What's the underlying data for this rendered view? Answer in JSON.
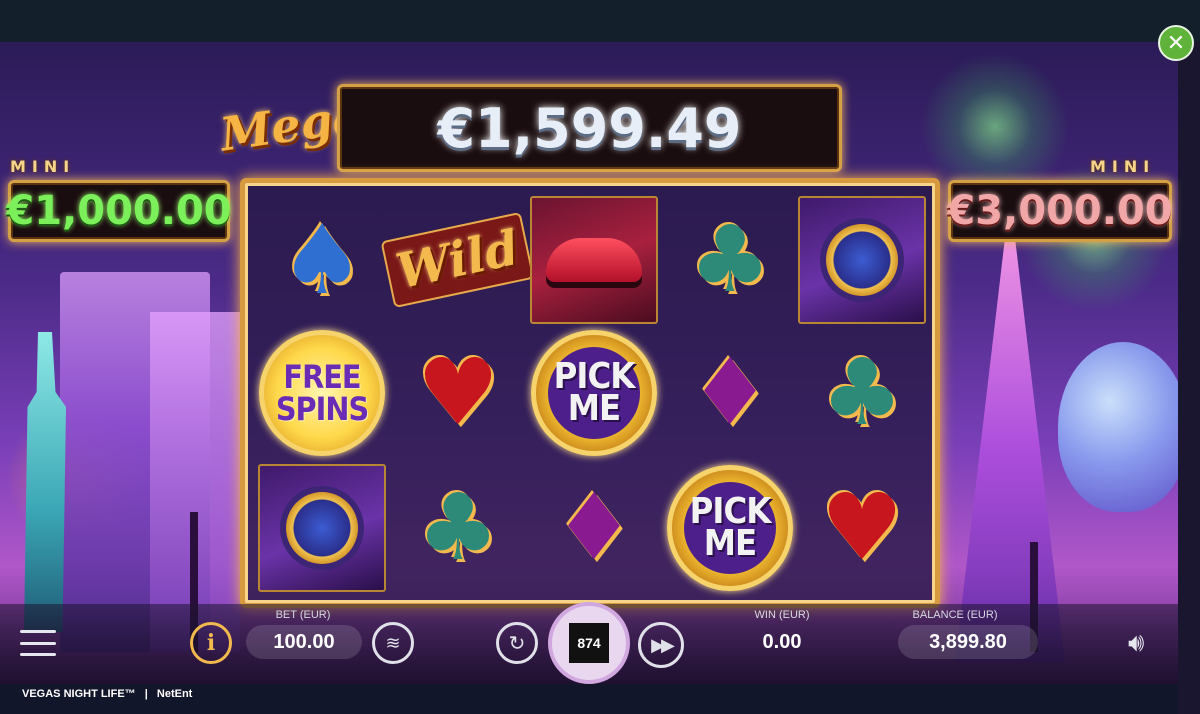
{
  "jackpots": {
    "mini_left": {
      "label": "MINI",
      "amount": "€1,000.00"
    },
    "mega": {
      "label": "Mega",
      "amount": "€1,599.49"
    },
    "mini_right": {
      "label": "MINI",
      "amount": "€3,000.00"
    }
  },
  "reels": {
    "symbols": [
      [
        "spade",
        "wild",
        "car",
        "club",
        "watch"
      ],
      [
        "free-spins",
        "heart",
        "pick-me",
        "diamond",
        "club"
      ],
      [
        "watch",
        "club",
        "diamond",
        "pick-me",
        "heart"
      ]
    ],
    "wild_text": "Wild",
    "free_spins_text": "FREE SPINS",
    "pick_me_text": "PICK ME"
  },
  "controls": {
    "bet_label": "BET (EUR)",
    "bet_value": "100.00",
    "win_label": "WIN (EUR)",
    "win_value": "0.00",
    "balance_label": "BALANCE (EUR)",
    "balance_value": "3,899.80",
    "spin_counter": "874"
  },
  "footer": {
    "game_name": "VEGAS NIGHT LIFE™",
    "separator": "|",
    "provider": "NetEnt"
  },
  "colors": {
    "frame_gold": "#d79a3e",
    "close_green": "#5fb33a",
    "mini_green": "#7cf05a"
  },
  "icons": [
    "close-icon",
    "menu-icon",
    "info-icon",
    "coins-icon",
    "autoplay-icon",
    "spin-icon",
    "turbo-icon",
    "sound-icon"
  ]
}
